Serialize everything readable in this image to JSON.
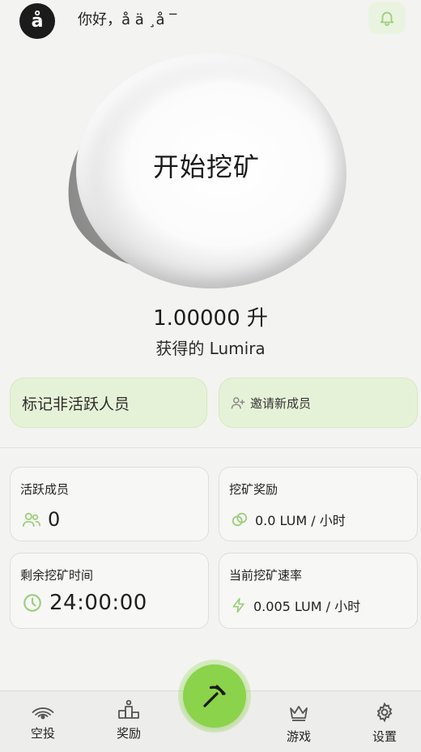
{
  "header": {
    "avatar_letter": "å",
    "greeting": "你好，å ä ¸å  ‾"
  },
  "mining": {
    "start_label": "开始挖矿",
    "balance": "1.00000 升",
    "balance_caption": "获得的 Lumira"
  },
  "actions": {
    "mark_inactive": "标记非活跃人员",
    "invite_members": "邀请新成员"
  },
  "stats": {
    "active_members": {
      "title": "活跃成员",
      "value": "0"
    },
    "mining_reward": {
      "title": "挖矿奖励",
      "value": "0.0 LUM / 小时"
    },
    "remaining_time": {
      "title": "剩余挖矿时间",
      "value": "24:00:00"
    },
    "mining_rate": {
      "title": "当前挖矿速率",
      "value": "0.005 LUM / 小时"
    }
  },
  "nav": {
    "airdrop": "空投",
    "reward": "奖励",
    "game": "游戏",
    "settings": "设置"
  },
  "colors": {
    "accent_green": "#8bd34a",
    "soft_green": "#e6f2d7",
    "icon_green": "#9ccf7c"
  },
  "icons": {
    "bell": "bell-icon",
    "invite": "add-user-icon",
    "members": "users-icon",
    "reward": "coin-icon",
    "clock": "clock-icon",
    "rate": "lightning-icon",
    "airdrop": "signal-icon",
    "reward_nav": "podium-icon",
    "game": "crown-icon",
    "settings": "gear-icon",
    "fab": "pickaxe-icon"
  }
}
